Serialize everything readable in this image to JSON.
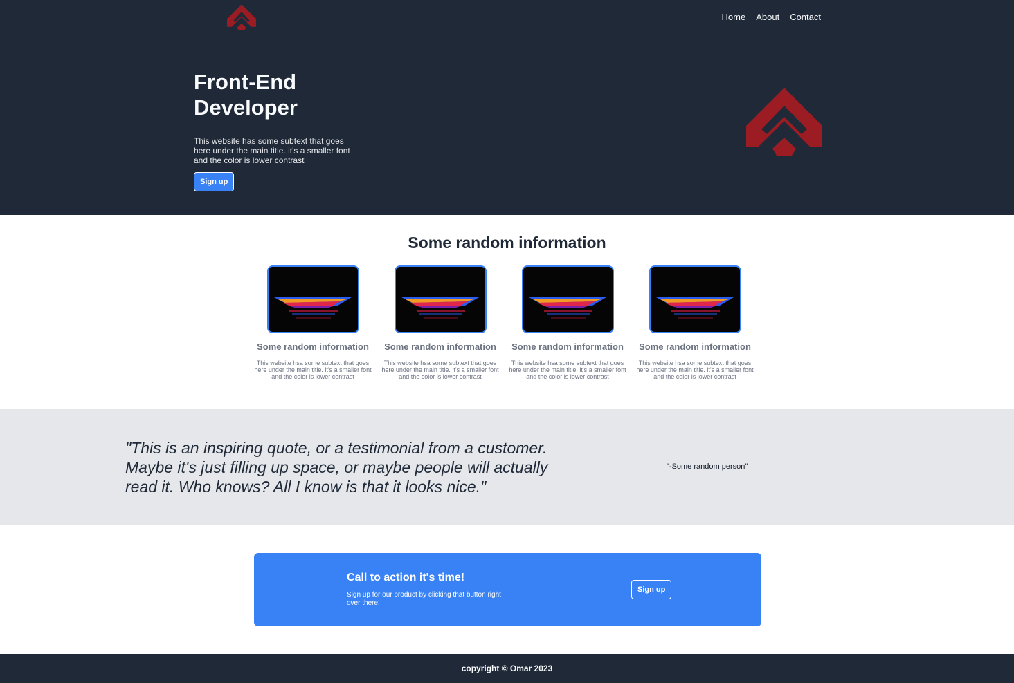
{
  "header": {
    "nav": [
      "Home",
      "About",
      "Contact"
    ]
  },
  "hero": {
    "title": "Front-End Developer",
    "subtitle": "This website has some subtext that goes here under the main title. it's a smaller font and the color is lower contrast",
    "button_label": "Sign up"
  },
  "info": {
    "heading": "Some random information",
    "cards": [
      {
        "title": "Some random information",
        "text": "This website hsa some subtext that goes here under the main title. it's a smaller font and the color is lower contrast"
      },
      {
        "title": "Some random information",
        "text": "This website hsa some subtext that goes here under the main title. it's a smaller font and the color is lower contrast"
      },
      {
        "title": "Some random information",
        "text": "This website hsa some subtext that goes here under the main title. it's a smaller font and the color is lower contrast"
      },
      {
        "title": "Some random information",
        "text": "This website hsa some subtext that goes here under the main title. it's a smaller font and the color is lower contrast"
      }
    ]
  },
  "quote": {
    "text": "\"This is an inspiring quote, or a testimonial from a customer. Maybe it's just filling up space, or maybe people will actually read it. Who knows? All I know is that it looks nice.\"",
    "author": "\"-Some random person\""
  },
  "cta": {
    "title": "Call to action it's time!",
    "subtitle": "Sign up for our product by clicking that button right over there!",
    "button_label": "Sign up"
  },
  "footer": {
    "copyright": "copyright © Omar 2023"
  },
  "colors": {
    "dark": "#1f2937",
    "accent": "#3882f6",
    "logo": "#9b1c23",
    "light_gray": "#e5e7eb"
  }
}
